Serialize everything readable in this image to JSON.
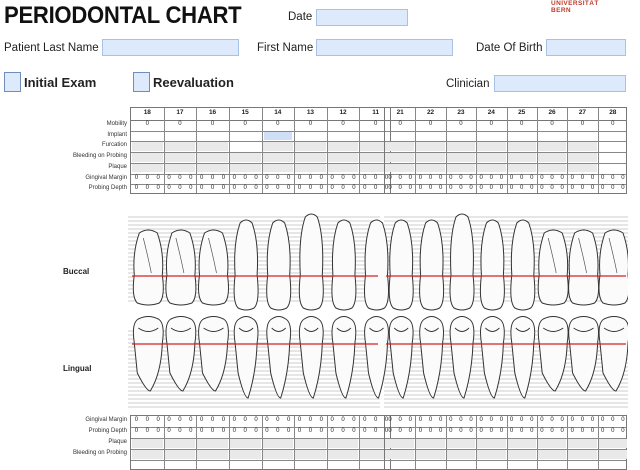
{
  "header": {
    "title": "PERIODONTAL CHART",
    "date_label": "Date",
    "logo": [
      "UNIVERSITÄT",
      "BERN"
    ]
  },
  "patient": {
    "last_name_label": "Patient Last Name",
    "first_name_label": "First Name",
    "dob_label": "Date Of Birth",
    "clinician_label": "Clinician"
  },
  "exam": {
    "initial_label": "Initial Exam",
    "reevaluation_label": "Reevaluation"
  },
  "upper_chart": {
    "teeth_left": [
      "18",
      "17",
      "16",
      "15",
      "14",
      "13",
      "12",
      "11"
    ],
    "teeth_right": [
      "21",
      "22",
      "23",
      "24",
      "25",
      "26",
      "27",
      "28"
    ],
    "rows": [
      "Mobility",
      "Implant",
      "Furcation",
      "Bleeding on Probing",
      "Plaque",
      "Gingival Margin",
      "Probing Depth"
    ],
    "mobility_values": [
      "0",
      "0",
      "0",
      "0",
      "0",
      "0",
      "0",
      "0",
      "0",
      "0",
      "0",
      "0",
      "0",
      "0",
      "0",
      "0"
    ],
    "triple_value": "0"
  },
  "diagram": {
    "buccal_label": "Buccal",
    "lingual_label": "Lingual"
  },
  "lower_chart": {
    "rows": [
      "Gingival Margin",
      "Probing Depth",
      "Plaque",
      "Bleeding on Probing"
    ],
    "triple_value": "0"
  },
  "colors": {
    "field_fill": "#ddeafc",
    "gum_line": "#d62020",
    "logo": "#c0392b"
  }
}
